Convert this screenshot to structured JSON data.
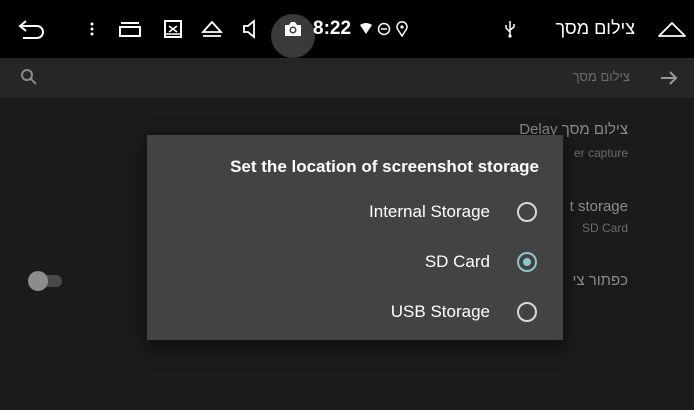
{
  "status_bar": {
    "time": "8:22",
    "title": "צילום מסך",
    "icons": [
      "back-icon",
      "menu-dots-icon",
      "recent-apps-icon",
      "screenshot-thumbnail-icon",
      "eject-icon",
      "volume-icon",
      "camera-icon",
      "wifi-icon",
      "do-not-disturb-icon",
      "location-icon",
      "usb-icon",
      "home-icon"
    ]
  },
  "action_bar": {
    "title": "צילום מסך"
  },
  "list": {
    "items": [
      {
        "title": "צילום מסך Delay",
        "subtitle": "er capture"
      },
      {
        "title": "t storage",
        "subtitle": "SD Card"
      },
      {
        "title": "כפתור צי"
      }
    ]
  },
  "dialog": {
    "title": "Set the location of screenshot storage",
    "options": [
      {
        "label": "Internal Storage",
        "checked": false
      },
      {
        "label": "SD Card",
        "checked": true
      },
      {
        "label": "USB Storage",
        "checked": false
      }
    ]
  },
  "colors": {
    "accent": "#8cc9c9",
    "dialog_bg": "#434343",
    "status_bar_bg": "#000000"
  }
}
